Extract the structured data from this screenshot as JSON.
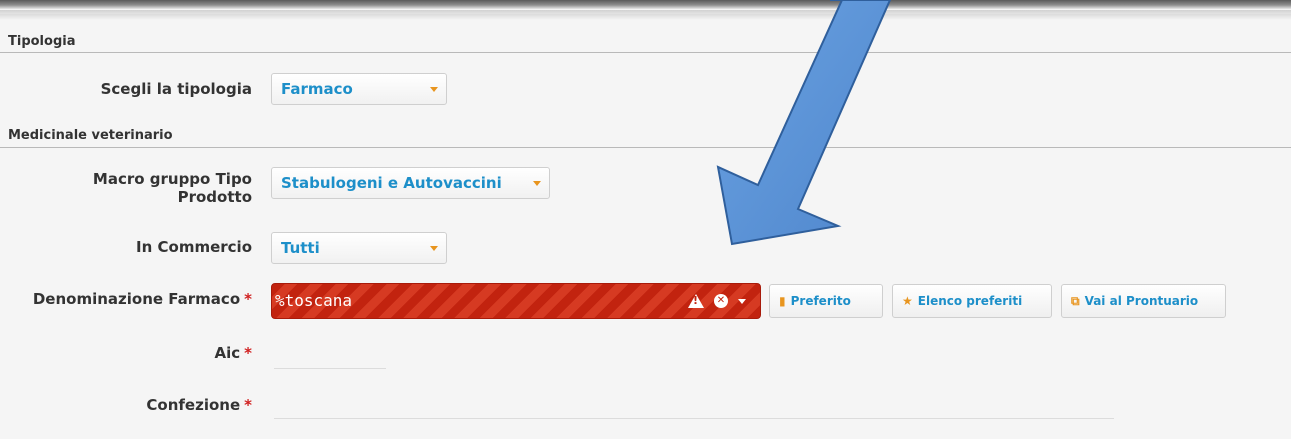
{
  "sections": {
    "tipologia": "Tipologia",
    "medicinale": "Medicinale veterinario"
  },
  "fields": {
    "tipologia": {
      "label": "Scegli la tipologia",
      "value": "Farmaco"
    },
    "macro_gruppo": {
      "label_line1": "Macro gruppo Tipo",
      "label_line2": "Prodotto",
      "value": "Stabulogeni e Autovaccini"
    },
    "in_commercio": {
      "label": "In Commercio",
      "value": "Tutti"
    },
    "denominazione": {
      "label": "Denominazione Farmaco",
      "value": "%toscana",
      "required": "*"
    },
    "aic": {
      "label": "Aic",
      "required": "*"
    },
    "confezione": {
      "label": "Confezione",
      "required": "*"
    }
  },
  "buttons": {
    "preferito": "Preferito",
    "elenco_preferiti": "Elenco preferiti",
    "vai_prontuario": "Vai al Prontuario"
  },
  "icons": {
    "preferito": "bookmark-icon",
    "elenco_preferiti": "star-icon",
    "vai_prontuario": "external-link-icon",
    "warning": "warning-icon",
    "clear": "clear-icon",
    "annotation": "arrow-annotation"
  },
  "colors": {
    "accent": "#1d8fc9",
    "caret": "#e8951f",
    "error": "#c2230f",
    "arrow": "#5b93d8"
  }
}
